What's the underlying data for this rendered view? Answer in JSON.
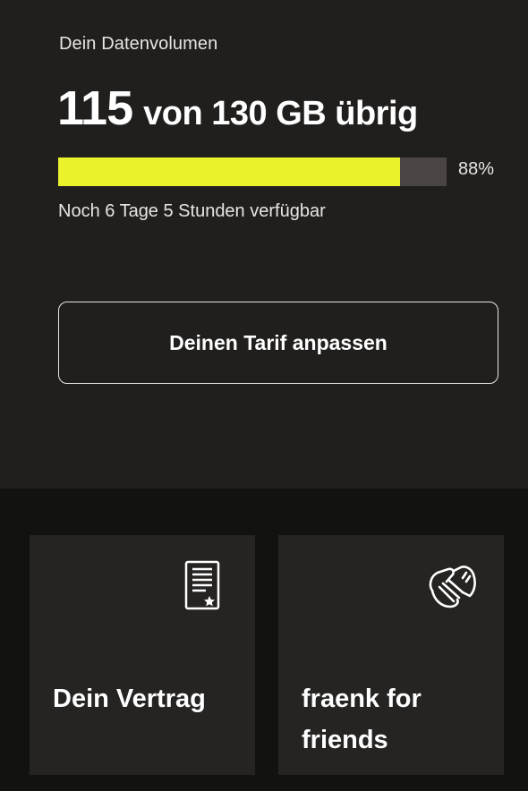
{
  "data_volume": {
    "label": "Dein Datenvolumen",
    "remaining_value": "115",
    "remaining_suffix": "von 130 GB übrig",
    "remaining_gb": 115,
    "total_gb": 130,
    "percent_value": 0.88,
    "percent_label": "88%",
    "time_left": "Noch 6 Tage 5 Stunden verfügbar",
    "bar_color": "#eaf22c",
    "track_color": "#4a4542"
  },
  "actions": {
    "tariff_button": "Deinen Tarif anpassen"
  },
  "cards": [
    {
      "title": "Dein Vertrag",
      "icon": "contract-document-icon"
    },
    {
      "title": "fraenk for friends",
      "icon": "handshake-icon"
    }
  ],
  "colors": {
    "background_top": "#211f1d",
    "background_bottom": "#121211",
    "card_background": "#262422",
    "accent": "#eaf22c"
  }
}
